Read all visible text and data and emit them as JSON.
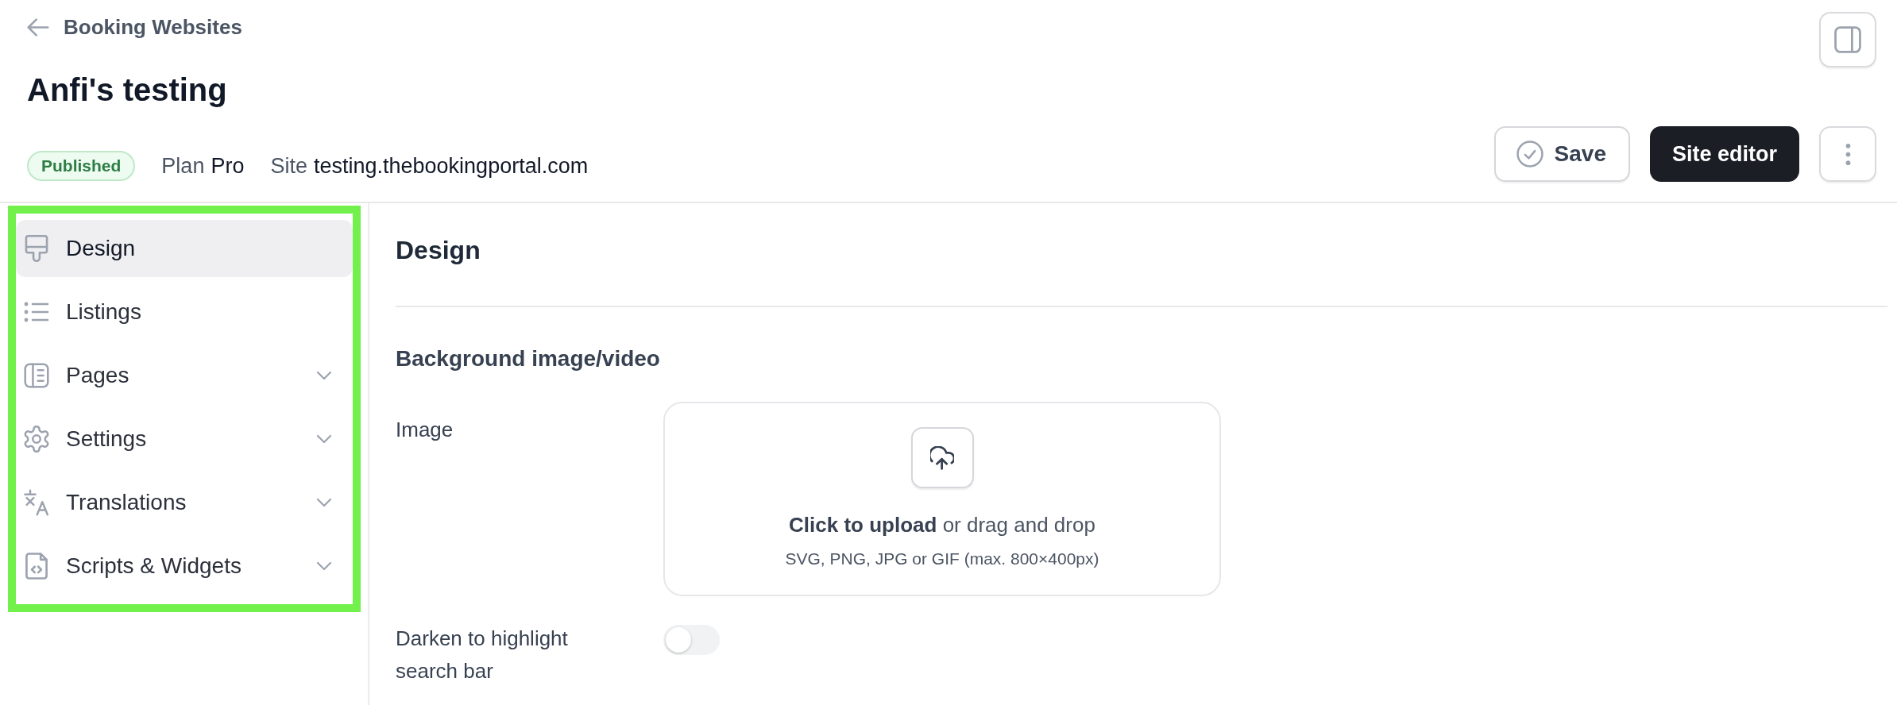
{
  "header": {
    "back_link": "Booking Websites",
    "title": "Anfi's testing",
    "status_badge": "Published",
    "plan": {
      "label": "Plan",
      "value": "Pro"
    },
    "site": {
      "label": "Site",
      "value": "testing.thebookingportal.com"
    },
    "save_button": "Save",
    "primary_button": "Site editor"
  },
  "sidebar": {
    "highlighted": true,
    "items": [
      {
        "label": "Design",
        "selected": true,
        "has_submenu": false
      },
      {
        "label": "Listings",
        "selected": false,
        "has_submenu": false
      },
      {
        "label": "Pages",
        "selected": false,
        "has_submenu": true
      },
      {
        "label": "Settings",
        "selected": false,
        "has_submenu": true
      },
      {
        "label": "Translations",
        "selected": false,
        "has_submenu": true
      },
      {
        "label": "Scripts & Widgets",
        "selected": false,
        "has_submenu": true
      }
    ]
  },
  "content": {
    "title": "Design",
    "section_title": "Background image/video",
    "fields": [
      {
        "kind": "upload",
        "label": "Image",
        "instructions": "**Click to upload** or drag and drop",
        "hint": "SVG, PNG, JPG or GIF (max. 800×400px)"
      },
      {
        "kind": "toggle",
        "label": "Darken to highlight search bar",
        "on": false
      }
    ]
  }
}
